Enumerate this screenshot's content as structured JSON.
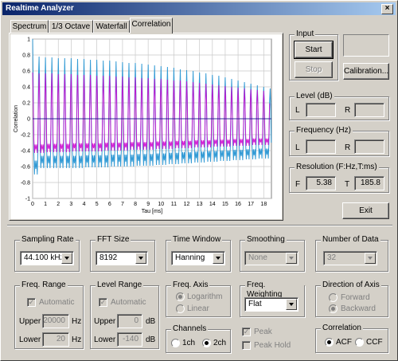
{
  "window": {
    "title": "Realtime Analyzer",
    "close_glyph": "×"
  },
  "tabs": [
    "Spectrum",
    "1/3 Octave",
    "Waterfall",
    "Correlation"
  ],
  "active_tab": "Correlation",
  "input": {
    "title": "Input",
    "start": "Start",
    "stop": "Stop",
    "calibration": "Calibration..."
  },
  "level": {
    "title": "Level (dB)",
    "l": "L",
    "r": "R",
    "l_value": "",
    "r_value": ""
  },
  "frequency": {
    "title": "Frequency (Hz)",
    "l": "L",
    "r": "R",
    "l_value": "",
    "r_value": ""
  },
  "resolution": {
    "title": "Resolution (F:Hz,T:ms)",
    "f": "F",
    "f_value": "5.38",
    "t": "T",
    "t_value": "185.8"
  },
  "exit": "Exit",
  "sampling_rate": {
    "title": "Sampling Rate",
    "value": "44.100 kHz"
  },
  "fft_size": {
    "title": "FFT Size",
    "value": "8192"
  },
  "time_window": {
    "title": "Time Window",
    "value": "Hanning"
  },
  "smoothing": {
    "title": "Smoothing",
    "value": "None"
  },
  "number_of_data": {
    "title": "Number of Data",
    "value": "32"
  },
  "freq_range": {
    "title": "Freq. Range",
    "automatic": "Automatic",
    "upper": "Upper",
    "upper_value": "20000",
    "upper_unit": "Hz",
    "lower": "Lower",
    "lower_value": "20",
    "lower_unit": "Hz"
  },
  "level_range": {
    "title": "Level Range",
    "automatic": "Automatic",
    "upper": "Upper",
    "upper_value": "0",
    "upper_unit": "dB",
    "lower": "Lower",
    "lower_value": "-140",
    "lower_unit": "dB"
  },
  "freq_axis": {
    "title": "Freq. Axis",
    "logarithm": "Logarithm",
    "linear": "Linear"
  },
  "channels": {
    "title": "Channels",
    "ch1": "1ch",
    "ch2": "2ch"
  },
  "freq_weighting": {
    "title": "Freq. Weighting",
    "value": "Flat"
  },
  "peak": {
    "peak": "Peak",
    "peak_hold": "Peak Hold"
  },
  "direction": {
    "title": "Direction of Axis",
    "forward": "Forward",
    "backward": "Backward"
  },
  "correlation": {
    "title": "Correlation",
    "acf": "ACF",
    "ccf": "CCF"
  },
  "chart_data": {
    "type": "line",
    "ylabel": "Correlation",
    "xlabel": "Tau [ms]",
    "xlim": [
      0,
      18.6
    ],
    "ylim": [
      -1,
      1
    ],
    "x_ticks": [
      "0",
      "1",
      "2",
      "3",
      "4",
      "5",
      "6",
      "7",
      "8",
      "9",
      "10",
      "11",
      "12",
      "13",
      "14",
      "15",
      "16",
      "17",
      "18"
    ],
    "y_ticks": [
      "1",
      "0.8",
      "0.6",
      "0.4",
      "0.2",
      "0",
      "-0.2",
      "-0.4",
      "-0.6",
      "-0.8",
      "-1"
    ],
    "grid": true,
    "peak_period_ms": 0.5,
    "series": [
      {
        "color": "#1e90d0",
        "peaks": [
          1.0,
          0.78,
          0.77,
          0.77,
          0.76,
          0.76,
          0.76,
          0.75,
          0.75,
          0.74,
          0.74,
          0.73,
          0.73,
          0.72,
          0.71,
          0.7,
          0.7,
          0.69,
          0.68,
          0.67,
          0.66,
          0.65,
          0.64,
          0.62,
          0.61,
          0.6,
          0.58,
          0.57,
          0.55,
          0.54,
          0.52,
          0.5,
          0.48,
          0.46,
          0.44,
          0.42,
          0.4,
          0.38
        ],
        "troughs": [
          -0.7,
          -0.62,
          -0.62,
          -0.62,
          -0.62,
          -0.62,
          -0.62,
          -0.62,
          -0.61,
          -0.61,
          -0.61,
          -0.61,
          -0.6,
          -0.6,
          -0.6,
          -0.6,
          -0.59,
          -0.59,
          -0.59,
          -0.58,
          -0.58,
          -0.57,
          -0.57,
          -0.56,
          -0.56,
          -0.55,
          -0.55,
          -0.54,
          -0.54,
          -0.53,
          -0.53,
          -0.52,
          -0.52,
          -0.51,
          -0.51,
          -0.5,
          -0.5
        ]
      },
      {
        "color": "#cc00cc",
        "peaks": [
          0.58,
          0.57,
          0.57,
          0.57,
          0.56,
          0.56,
          0.56,
          0.55,
          0.55,
          0.55,
          0.54,
          0.54,
          0.54,
          0.53,
          0.53,
          0.52,
          0.52,
          0.51,
          0.51,
          0.5,
          0.5,
          0.49,
          0.48,
          0.48,
          0.47,
          0.46,
          0.45,
          0.44,
          0.43,
          0.42,
          0.41,
          0.4,
          0.39,
          0.38,
          0.37,
          0.36,
          0.35
        ],
        "troughs": [
          -0.43,
          -0.43,
          -0.42,
          -0.42,
          -0.42,
          -0.42,
          -0.41,
          -0.41,
          -0.41,
          -0.41,
          -0.41,
          -0.4,
          -0.4,
          -0.4,
          -0.4,
          -0.39,
          -0.39,
          -0.39,
          -0.39,
          -0.38,
          -0.38,
          -0.38,
          -0.37,
          -0.37,
          -0.37,
          -0.36,
          -0.36,
          -0.36,
          -0.35,
          -0.35,
          -0.35,
          -0.34,
          -0.34,
          -0.34,
          -0.33,
          -0.33,
          -0.33
        ]
      }
    ]
  }
}
